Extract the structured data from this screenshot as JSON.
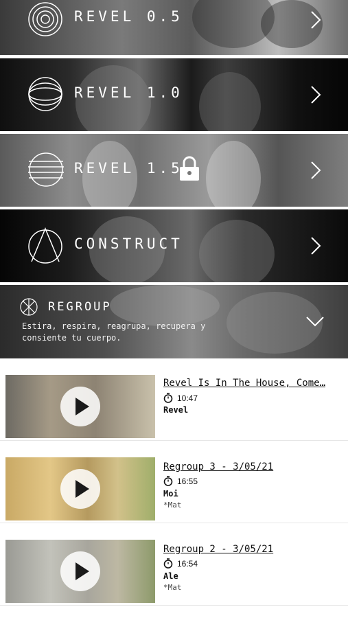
{
  "programs": [
    {
      "title": "REVEL 0.5",
      "icon": "concentric-circles-icon"
    },
    {
      "title": "REVEL 1.0",
      "icon": "globe-circle-icon"
    },
    {
      "title": "REVEL 1.5",
      "icon": "striped-circle-icon",
      "locked": true
    },
    {
      "title": "CONSTRUCT",
      "icon": "triangle-circle-icon"
    }
  ],
  "regroup": {
    "title": "REGROUP",
    "description": "Estira, respira, reagrupa, recupera y consiente tu cuerpo.",
    "icon": "crossed-circle-icon"
  },
  "videos": [
    {
      "title": "Revel Is In The House, Come…",
      "duration": "10:47",
      "instructor": "Revel",
      "equipment": ""
    },
    {
      "title": "Regroup 3 - 3/05/21",
      "duration": "16:55",
      "instructor": "Moi",
      "equipment": "*Mat"
    },
    {
      "title": "Regroup 2 - 3/05/21",
      "duration": "16:54",
      "instructor": "Ale",
      "equipment": "*Mat"
    }
  ]
}
